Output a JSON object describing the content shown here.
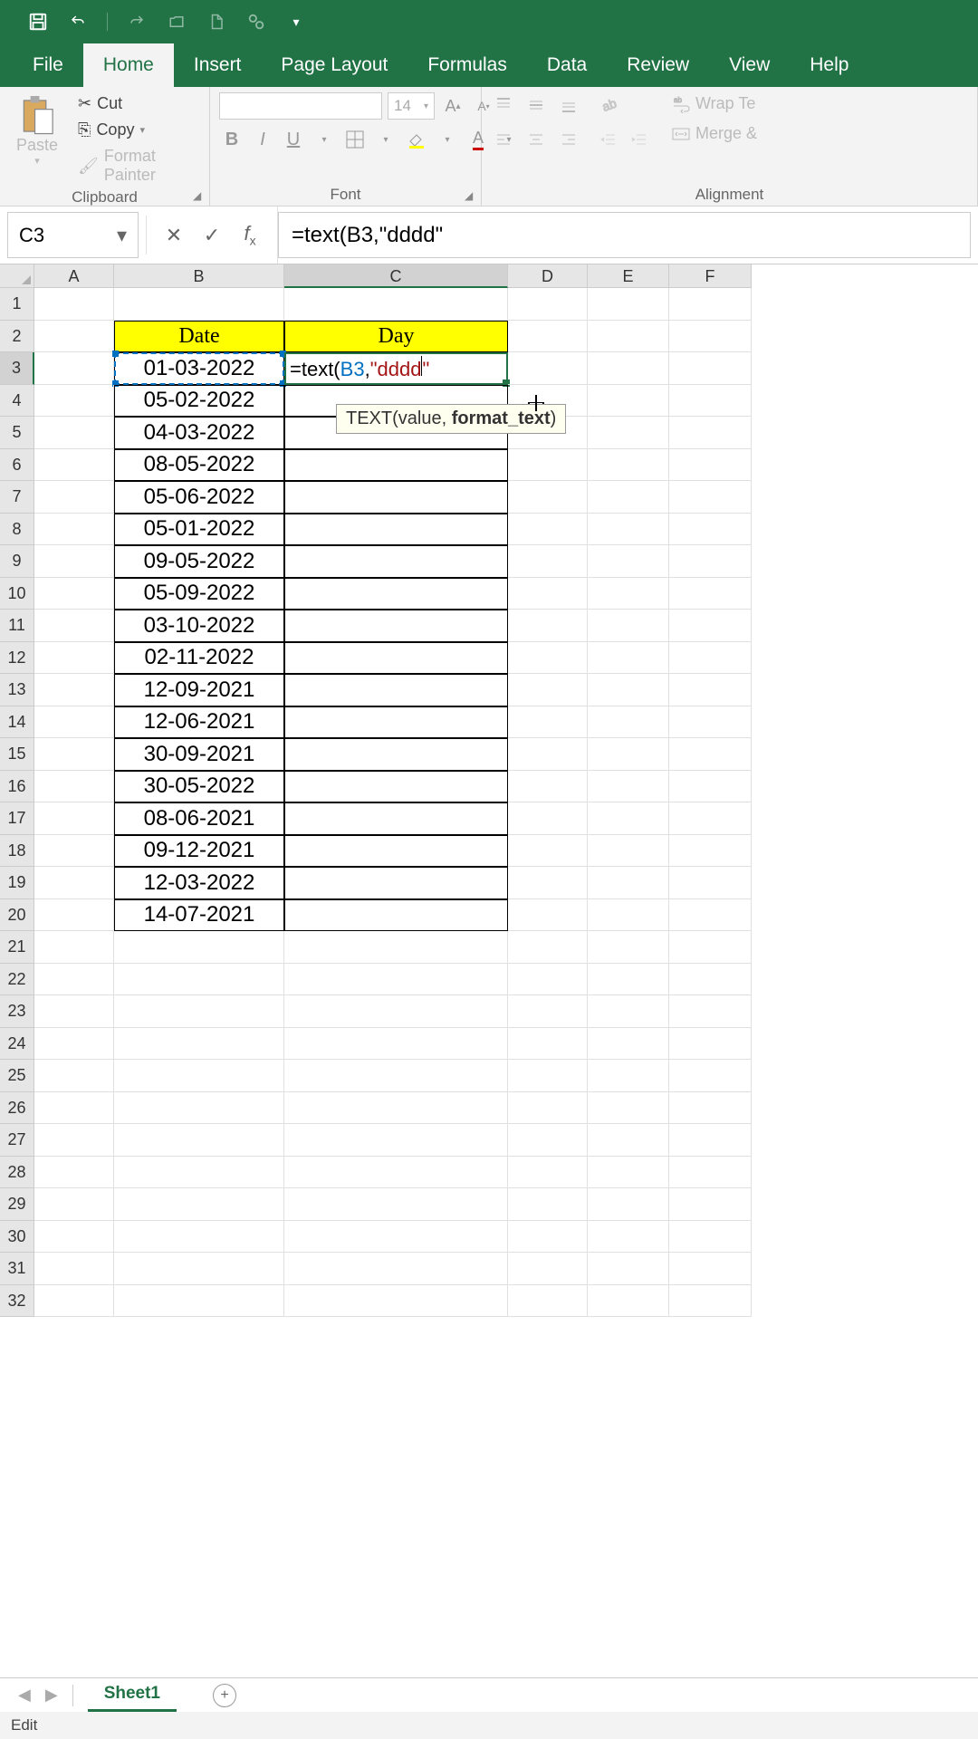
{
  "qat": {
    "save": "save-icon",
    "undo": "undo-icon",
    "redo": "redo-icon"
  },
  "tabs": [
    "File",
    "Home",
    "Insert",
    "Page Layout",
    "Formulas",
    "Data",
    "Review",
    "View",
    "Help"
  ],
  "active_tab": "Home",
  "clipboard": {
    "paste": "Paste",
    "cut": "Cut",
    "copy": "Copy",
    "format_painter": "Format Painter",
    "label": "Clipboard"
  },
  "font": {
    "size": "14",
    "label": "Font"
  },
  "alignment": {
    "merge": "Merge &",
    "wrap": "Wrap Te",
    "label": "Alignment"
  },
  "name_box": "C3",
  "formula_bar": "=text(B3,\"dddd\"",
  "tooltip": {
    "fn": "TEXT",
    "args": "(value, ",
    "bold_arg": "format_text",
    "close": ")"
  },
  "columns": [
    "A",
    "B",
    "C",
    "D",
    "E",
    "F"
  ],
  "col_widths": {
    "A": 88,
    "B": 188,
    "C": 247,
    "D": 88,
    "E": 90,
    "F": 91
  },
  "selected_col": "C",
  "selected_row": 3,
  "headers": {
    "B2": "Date",
    "C2": "Day"
  },
  "editing_formula": "=text(B3,\"dddd\"",
  "dates": [
    "01-03-2022",
    "05-02-2022",
    "04-03-2022",
    "08-05-2022",
    "05-06-2022",
    "05-01-2022",
    "09-05-2022",
    "05-09-2022",
    "03-10-2022",
    "02-11-2022",
    "12-09-2021",
    "12-06-2021",
    "30-09-2021",
    "30-05-2022",
    "08-06-2021",
    "09-12-2021",
    "12-03-2022",
    "14-07-2021"
  ],
  "sheet_name": "Sheet1",
  "status": "Edit",
  "visible_rows": 32
}
